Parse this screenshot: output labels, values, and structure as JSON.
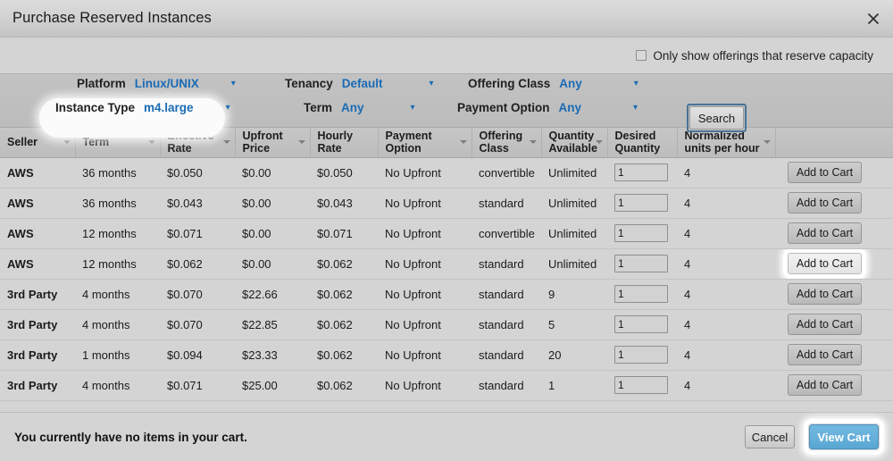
{
  "window": {
    "title": "Purchase Reserved Instances",
    "close_icon": "close-icon"
  },
  "capacity": {
    "label": "Only show offerings that reserve capacity",
    "checked": false
  },
  "filters": {
    "platform": {
      "label": "Platform",
      "value": "Linux/UNIX"
    },
    "instance_type": {
      "label": "Instance Type",
      "value": "m4.large",
      "highlighted": true
    },
    "tenancy": {
      "label": "Tenancy",
      "value": "Default"
    },
    "term": {
      "label": "Term",
      "value": "Any"
    },
    "offering_class": {
      "label": "Offering Class",
      "value": "Any"
    },
    "payment_option": {
      "label": "Payment Option",
      "value": "Any"
    },
    "search_button": {
      "label": "Search",
      "focused": true
    }
  },
  "table": {
    "columns": [
      {
        "label": "Seller",
        "sortable": true
      },
      {
        "label": "Term",
        "sortable": true
      },
      {
        "label": "Effective Rate",
        "sortable": true
      },
      {
        "label": "Upfront Price",
        "sortable": true
      },
      {
        "label": "Hourly Rate",
        "sortable": false
      },
      {
        "label": "Payment Option",
        "sortable": true
      },
      {
        "label": "Offering Class",
        "sortable": true
      },
      {
        "label": "Quantity Available",
        "sortable": true
      },
      {
        "label": "Desired Quantity",
        "sortable": false
      },
      {
        "label": "Normalized units per hour",
        "sortable": true
      },
      {
        "label": "",
        "sortable": false
      }
    ],
    "add_to_cart_label": "Add to Cart",
    "rows": [
      {
        "seller": "AWS",
        "term": "36 months",
        "effective_rate": "$0.050",
        "upfront_price": "$0.00",
        "hourly_rate": "$0.050",
        "payment_option": "No Upfront",
        "offering_class": "convertible",
        "quantity_available": "Unlimited",
        "desired_quantity": "1",
        "normalized_units": "4",
        "focused": false
      },
      {
        "seller": "AWS",
        "term": "36 months",
        "effective_rate": "$0.043",
        "upfront_price": "$0.00",
        "hourly_rate": "$0.043",
        "payment_option": "No Upfront",
        "offering_class": "standard",
        "quantity_available": "Unlimited",
        "desired_quantity": "1",
        "normalized_units": "4",
        "focused": false
      },
      {
        "seller": "AWS",
        "term": "12 months",
        "effective_rate": "$0.071",
        "upfront_price": "$0.00",
        "hourly_rate": "$0.071",
        "payment_option": "No Upfront",
        "offering_class": "convertible",
        "quantity_available": "Unlimited",
        "desired_quantity": "1",
        "normalized_units": "4",
        "focused": false
      },
      {
        "seller": "AWS",
        "term": "12 months",
        "effective_rate": "$0.062",
        "upfront_price": "$0.00",
        "hourly_rate": "$0.062",
        "payment_option": "No Upfront",
        "offering_class": "standard",
        "quantity_available": "Unlimited",
        "desired_quantity": "1",
        "normalized_units": "4",
        "focused": true
      },
      {
        "seller": "3rd Party",
        "term": "4 months",
        "effective_rate": "$0.070",
        "upfront_price": "$22.66",
        "hourly_rate": "$0.062",
        "payment_option": "No Upfront",
        "offering_class": "standard",
        "quantity_available": "9",
        "desired_quantity": "1",
        "normalized_units": "4",
        "focused": false
      },
      {
        "seller": "3rd Party",
        "term": "4 months",
        "effective_rate": "$0.070",
        "upfront_price": "$22.85",
        "hourly_rate": "$0.062",
        "payment_option": "No Upfront",
        "offering_class": "standard",
        "quantity_available": "5",
        "desired_quantity": "1",
        "normalized_units": "4",
        "focused": false
      },
      {
        "seller": "3rd Party",
        "term": "1 months",
        "effective_rate": "$0.094",
        "upfront_price": "$23.33",
        "hourly_rate": "$0.062",
        "payment_option": "No Upfront",
        "offering_class": "standard",
        "quantity_available": "20",
        "desired_quantity": "1",
        "normalized_units": "4",
        "focused": false
      },
      {
        "seller": "3rd Party",
        "term": "4 months",
        "effective_rate": "$0.071",
        "upfront_price": "$25.00",
        "hourly_rate": "$0.062",
        "payment_option": "No Upfront",
        "offering_class": "standard",
        "quantity_available": "1",
        "desired_quantity": "1",
        "normalized_units": "4",
        "focused": false
      }
    ]
  },
  "footer": {
    "cart_note": "You currently have no items in your cart.",
    "cancel_label": "Cancel",
    "view_cart_label": "View Cart",
    "view_cart_focused": true
  },
  "colors": {
    "link_blue": "#1a6bb5",
    "focus_blue": "#4a7397",
    "primary_button": "#5aa7d4",
    "panel_gray": "#c2c2c2",
    "page_gray": "#d4d4d4"
  }
}
